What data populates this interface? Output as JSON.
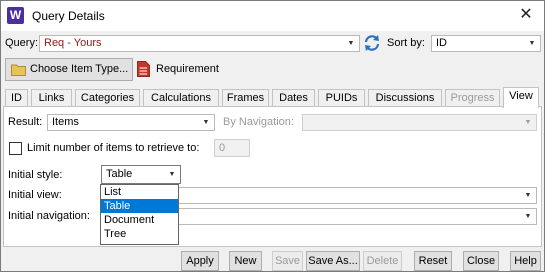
{
  "window": {
    "title": "Query Details",
    "app_icon_letter": "W",
    "close_glyph": "✕"
  },
  "query": {
    "label": "Query:",
    "value": "Req - Yours",
    "value_color": "#8b1a1a",
    "sort_label": "Sort by:",
    "sort_value": "ID"
  },
  "item_type": {
    "button_label": "Choose Item Type...",
    "value": "Requirement"
  },
  "tabs": [
    {
      "label": "ID",
      "enabled": true
    },
    {
      "label": "Links",
      "enabled": true
    },
    {
      "label": "Categories",
      "enabled": true
    },
    {
      "label": "Calculations",
      "enabled": true
    },
    {
      "label": "Frames",
      "enabled": true
    },
    {
      "label": "Dates",
      "enabled": true
    },
    {
      "label": "PUIDs",
      "enabled": true
    },
    {
      "label": "Discussions",
      "enabled": true
    },
    {
      "label": "Progress",
      "enabled": false
    },
    {
      "label": "View",
      "enabled": true,
      "active": true
    }
  ],
  "view": {
    "result_label": "Result:",
    "result_value": "Items",
    "by_navigation_label": "By Navigation:",
    "by_navigation_value": "",
    "limit_label": "Limit number of items to retrieve to:",
    "limit_checked": false,
    "limit_value": "0",
    "initial_style_label": "Initial style:",
    "initial_style_value": "Table",
    "initial_view_label": "Initial view:",
    "initial_view_value": "",
    "initial_navigation_label": "Initial navigation:",
    "initial_navigation_value": ""
  },
  "style_dropdown": {
    "options": [
      "List",
      "Table",
      "Document",
      "Tree"
    ],
    "selected": "Table"
  },
  "footer_buttons": [
    {
      "label": "Apply",
      "enabled": true
    },
    {
      "label": "New",
      "enabled": true
    },
    {
      "label": "Save",
      "enabled": false
    },
    {
      "label": "Save As...",
      "enabled": true
    },
    {
      "label": "Delete",
      "enabled": false
    },
    {
      "label": "Reset",
      "enabled": true
    },
    {
      "label": "Close",
      "enabled": true
    },
    {
      "label": "Help",
      "enabled": true
    }
  ],
  "colors": {
    "accent": "#0078d7",
    "app_icon": "#4a2fa0",
    "refresh_icon": "#2e6fc1",
    "document_icon": "#c0392b",
    "folder_icon": "#e8c35a"
  },
  "icons": [
    "app-icon",
    "close-icon",
    "refresh-icon",
    "folder-icon",
    "document-icon",
    "chevron-down-icon"
  ]
}
